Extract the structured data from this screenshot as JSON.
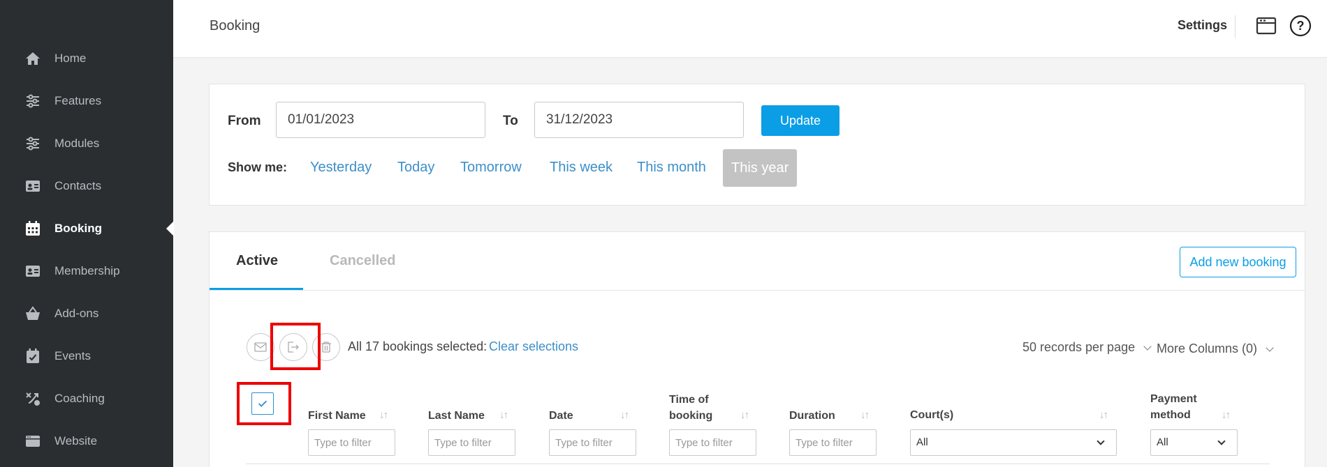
{
  "sidebar": {
    "items": [
      {
        "label": "Home",
        "icon": "home-icon"
      },
      {
        "label": "Features",
        "icon": "sliders-icon"
      },
      {
        "label": "Modules",
        "icon": "sliders-icon"
      },
      {
        "label": "Contacts",
        "icon": "contact-card-icon"
      },
      {
        "label": "Booking",
        "icon": "calendar-icon",
        "active": true
      },
      {
        "label": "Membership",
        "icon": "id-card-icon"
      },
      {
        "label": "Add-ons",
        "icon": "basket-icon"
      },
      {
        "label": "Events",
        "icon": "event-icon"
      },
      {
        "label": "Coaching",
        "icon": "coaching-icon"
      },
      {
        "label": "Website",
        "icon": "browser-icon"
      }
    ]
  },
  "header": {
    "title": "Booking",
    "settings_label": "Settings"
  },
  "date_filter": {
    "from_label": "From",
    "from_value": "01/01/2023",
    "to_label": "To",
    "to_value": "31/12/2023",
    "update_label": "Update",
    "show_me_label": "Show me:",
    "quick_options": [
      "Yesterday",
      "Today",
      "Tomorrow",
      "This week",
      "This month",
      "This year"
    ],
    "active_option": "This year"
  },
  "bookings": {
    "tabs": [
      "Active",
      "Cancelled"
    ],
    "active_tab": "Active",
    "add_button_label": "Add new booking",
    "selection_text": "All 17 bookings selected:",
    "clear_label": "Clear selections",
    "records_per_page": "50 records per page",
    "more_columns": "More Columns (0)",
    "select_all_checked": true,
    "columns": [
      {
        "label": "First Name",
        "filter_placeholder": "Type to filter"
      },
      {
        "label": "Last Name",
        "filter_placeholder": "Type to filter"
      },
      {
        "label": "Date",
        "filter_placeholder": "Type to filter"
      },
      {
        "label_line1": "Time of",
        "label_line2": "booking",
        "filter_placeholder": "Type to filter"
      },
      {
        "label": "Duration",
        "filter_placeholder": "Type to filter"
      },
      {
        "label": "Court(s)",
        "select_value": "All"
      },
      {
        "label_line1": "Payment",
        "label_line2": "method",
        "select_value": "All"
      }
    ]
  },
  "colors": {
    "sidebar_bg": "#2b2e31",
    "accent": "#0a9ee6",
    "link": "#3d8fc9",
    "highlight_box": "#ee0000"
  }
}
